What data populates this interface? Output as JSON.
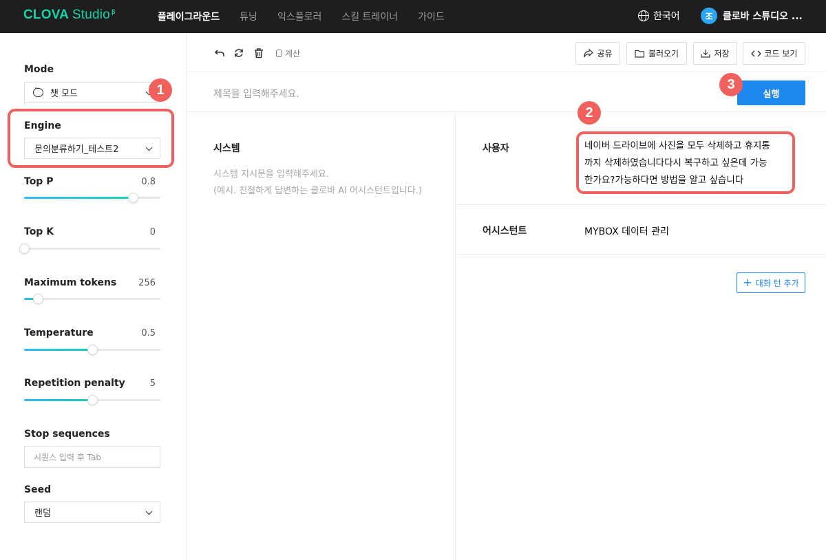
{
  "header": {
    "logo_brand": "CLOVA",
    "logo_studio": "Studio",
    "logo_mark": "β",
    "nav": [
      "플레이그라운드",
      "튜닝",
      "익스플로러",
      "스킬 트레이너",
      "가이드"
    ],
    "language": "한국어",
    "user_initial": "조",
    "user_name": "클로바 스튜디오 ..."
  },
  "sidebar": {
    "mode_label": "Mode",
    "mode_value": "챗 모드",
    "engine_label": "Engine",
    "engine_value": "문의분류하기_테스트2",
    "top_p_label": "Top P",
    "top_p_value": "0.8",
    "top_k_label": "Top K",
    "top_k_value": "0",
    "max_tokens_label": "Maximum tokens",
    "max_tokens_value": "256",
    "temperature_label": "Temperature",
    "temperature_value": "0.5",
    "repetition_label": "Repetition penalty",
    "repetition_value": "5",
    "stop_label": "Stop sequences",
    "stop_placeholder": "시퀀스 입력 후 Tab",
    "seed_label": "Seed",
    "seed_value": "랜덤",
    "slider_levels": {
      "top_p": 0.8,
      "top_k": 0.0,
      "max_tokens": 0.1,
      "temperature": 0.5,
      "repetition": 0.5
    }
  },
  "toolbar": {
    "calc_label": "계산",
    "share": "공유",
    "load": "불러오기",
    "save": "저장",
    "code": "코드 보기"
  },
  "title_placeholder": "제목을 입력해주세요.",
  "run_label": "실행",
  "system": {
    "title": "시스템",
    "placeholder_line1": "시스템 지시문을 입력해주세요.",
    "placeholder_line2": "(예시. 친절하게 답변하는 클로바 AI 어시스턴트입니다.)"
  },
  "chat": {
    "user_role": "사용자",
    "user_line1": "네이버 드라이브에 사진을 모두 삭제하고 휴지통",
    "user_line2": "까지 삭제하였습니다다시 복구하고 싶은데 가능",
    "user_line3": "한가요?가능하다면 방법을 알고 싶습니다",
    "assistant_role": "어시스턴트",
    "assistant_text": "MYBOX 데이터 관리",
    "add_turn": "대화 턴 추가"
  },
  "badges": [
    "1",
    "2",
    "3"
  ],
  "colors": {
    "accent": "#1e87f0",
    "highlight": "#f0605c",
    "logo": "#18d3a8",
    "topbar": "#1e1e1e"
  }
}
